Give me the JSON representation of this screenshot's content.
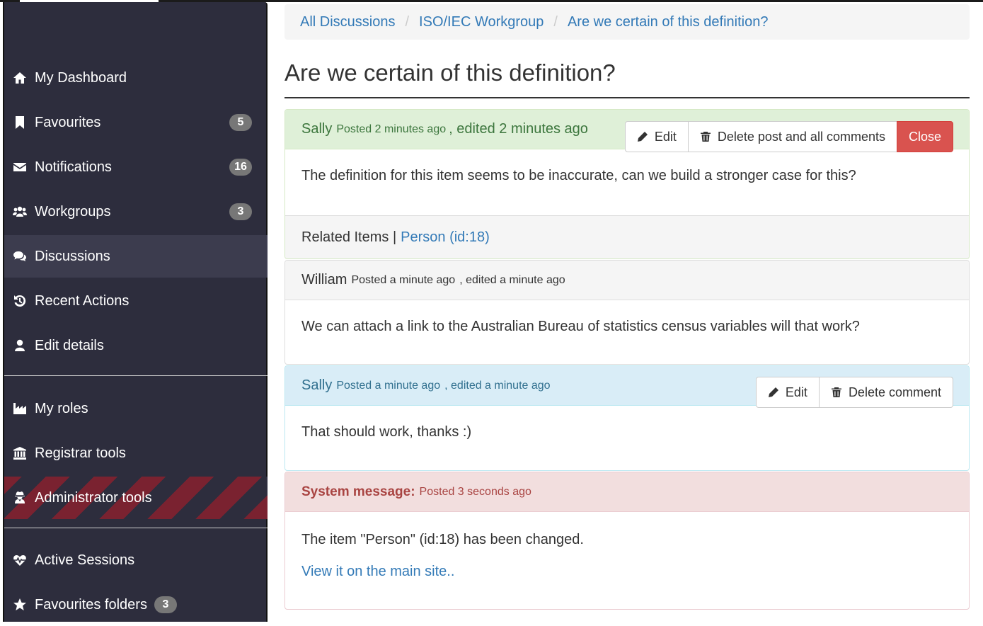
{
  "sidebar": {
    "items": [
      {
        "label": "My Dashboard",
        "icon": "home-icon"
      },
      {
        "label": "Favourites",
        "icon": "bookmark-icon",
        "badge": "5"
      },
      {
        "label": "Notifications",
        "icon": "envelope-icon",
        "badge": "16"
      },
      {
        "label": "Workgroups",
        "icon": "users-icon",
        "badge": "3"
      },
      {
        "label": "Discussions",
        "icon": "comments-icon",
        "active": true
      },
      {
        "label": "Recent Actions",
        "icon": "history-icon"
      },
      {
        "label": "Edit details",
        "icon": "user-icon"
      },
      {
        "label": "My roles",
        "icon": "industry-icon"
      },
      {
        "label": "Registrar tools",
        "icon": "university-icon"
      },
      {
        "label": "Administrator tools",
        "icon": "user-secret-icon"
      },
      {
        "label": "Active Sessions",
        "icon": "heartbeat-icon"
      },
      {
        "label": "Favourites folders",
        "icon": "star-icon",
        "badge": "3"
      }
    ]
  },
  "breadcrumb": {
    "items": [
      "All Discussions",
      "ISO/IEC Workgroup",
      "Are we certain of this definition?"
    ],
    "separator": "/"
  },
  "page_title": "Are we certain of this definition?",
  "posts": {
    "main": {
      "author": "Sally",
      "posted": "Posted 2 minutes ago",
      "edited": ", edited 2 minutes ago",
      "body": "The definition for this item seems to be inaccurate, can we build a stronger case for this?",
      "related_label": "Related Items |",
      "related_link": "Person (id:18)",
      "edit_label": "Edit",
      "delete_label": "Delete post and all comments",
      "close_label": "Close"
    },
    "comment1": {
      "author": "William",
      "posted": "Posted a minute ago",
      "edited": ", edited a minute ago",
      "body": "We can attach a link to the Australian Bureau of statistics census variables will that work?"
    },
    "comment2": {
      "author": "Sally",
      "posted": "Posted a minute ago",
      "edited": ", edited a minute ago",
      "body": "That should work, thanks :)",
      "edit_label": "Edit",
      "delete_label": "Delete comment"
    },
    "system": {
      "label": "System message:",
      "posted": "Posted 3 seconds ago",
      "body": "The item \"Person\" (id:18) has been changed.",
      "link": "View it on the main site.."
    }
  },
  "colors": {
    "sidebar_bg": "#2d2d3d",
    "link": "#337ab7",
    "success_bg": "#dff0d8",
    "info_bg": "#d9edf7",
    "danger_bg": "#f2dede",
    "danger_button": "#d9534f"
  }
}
